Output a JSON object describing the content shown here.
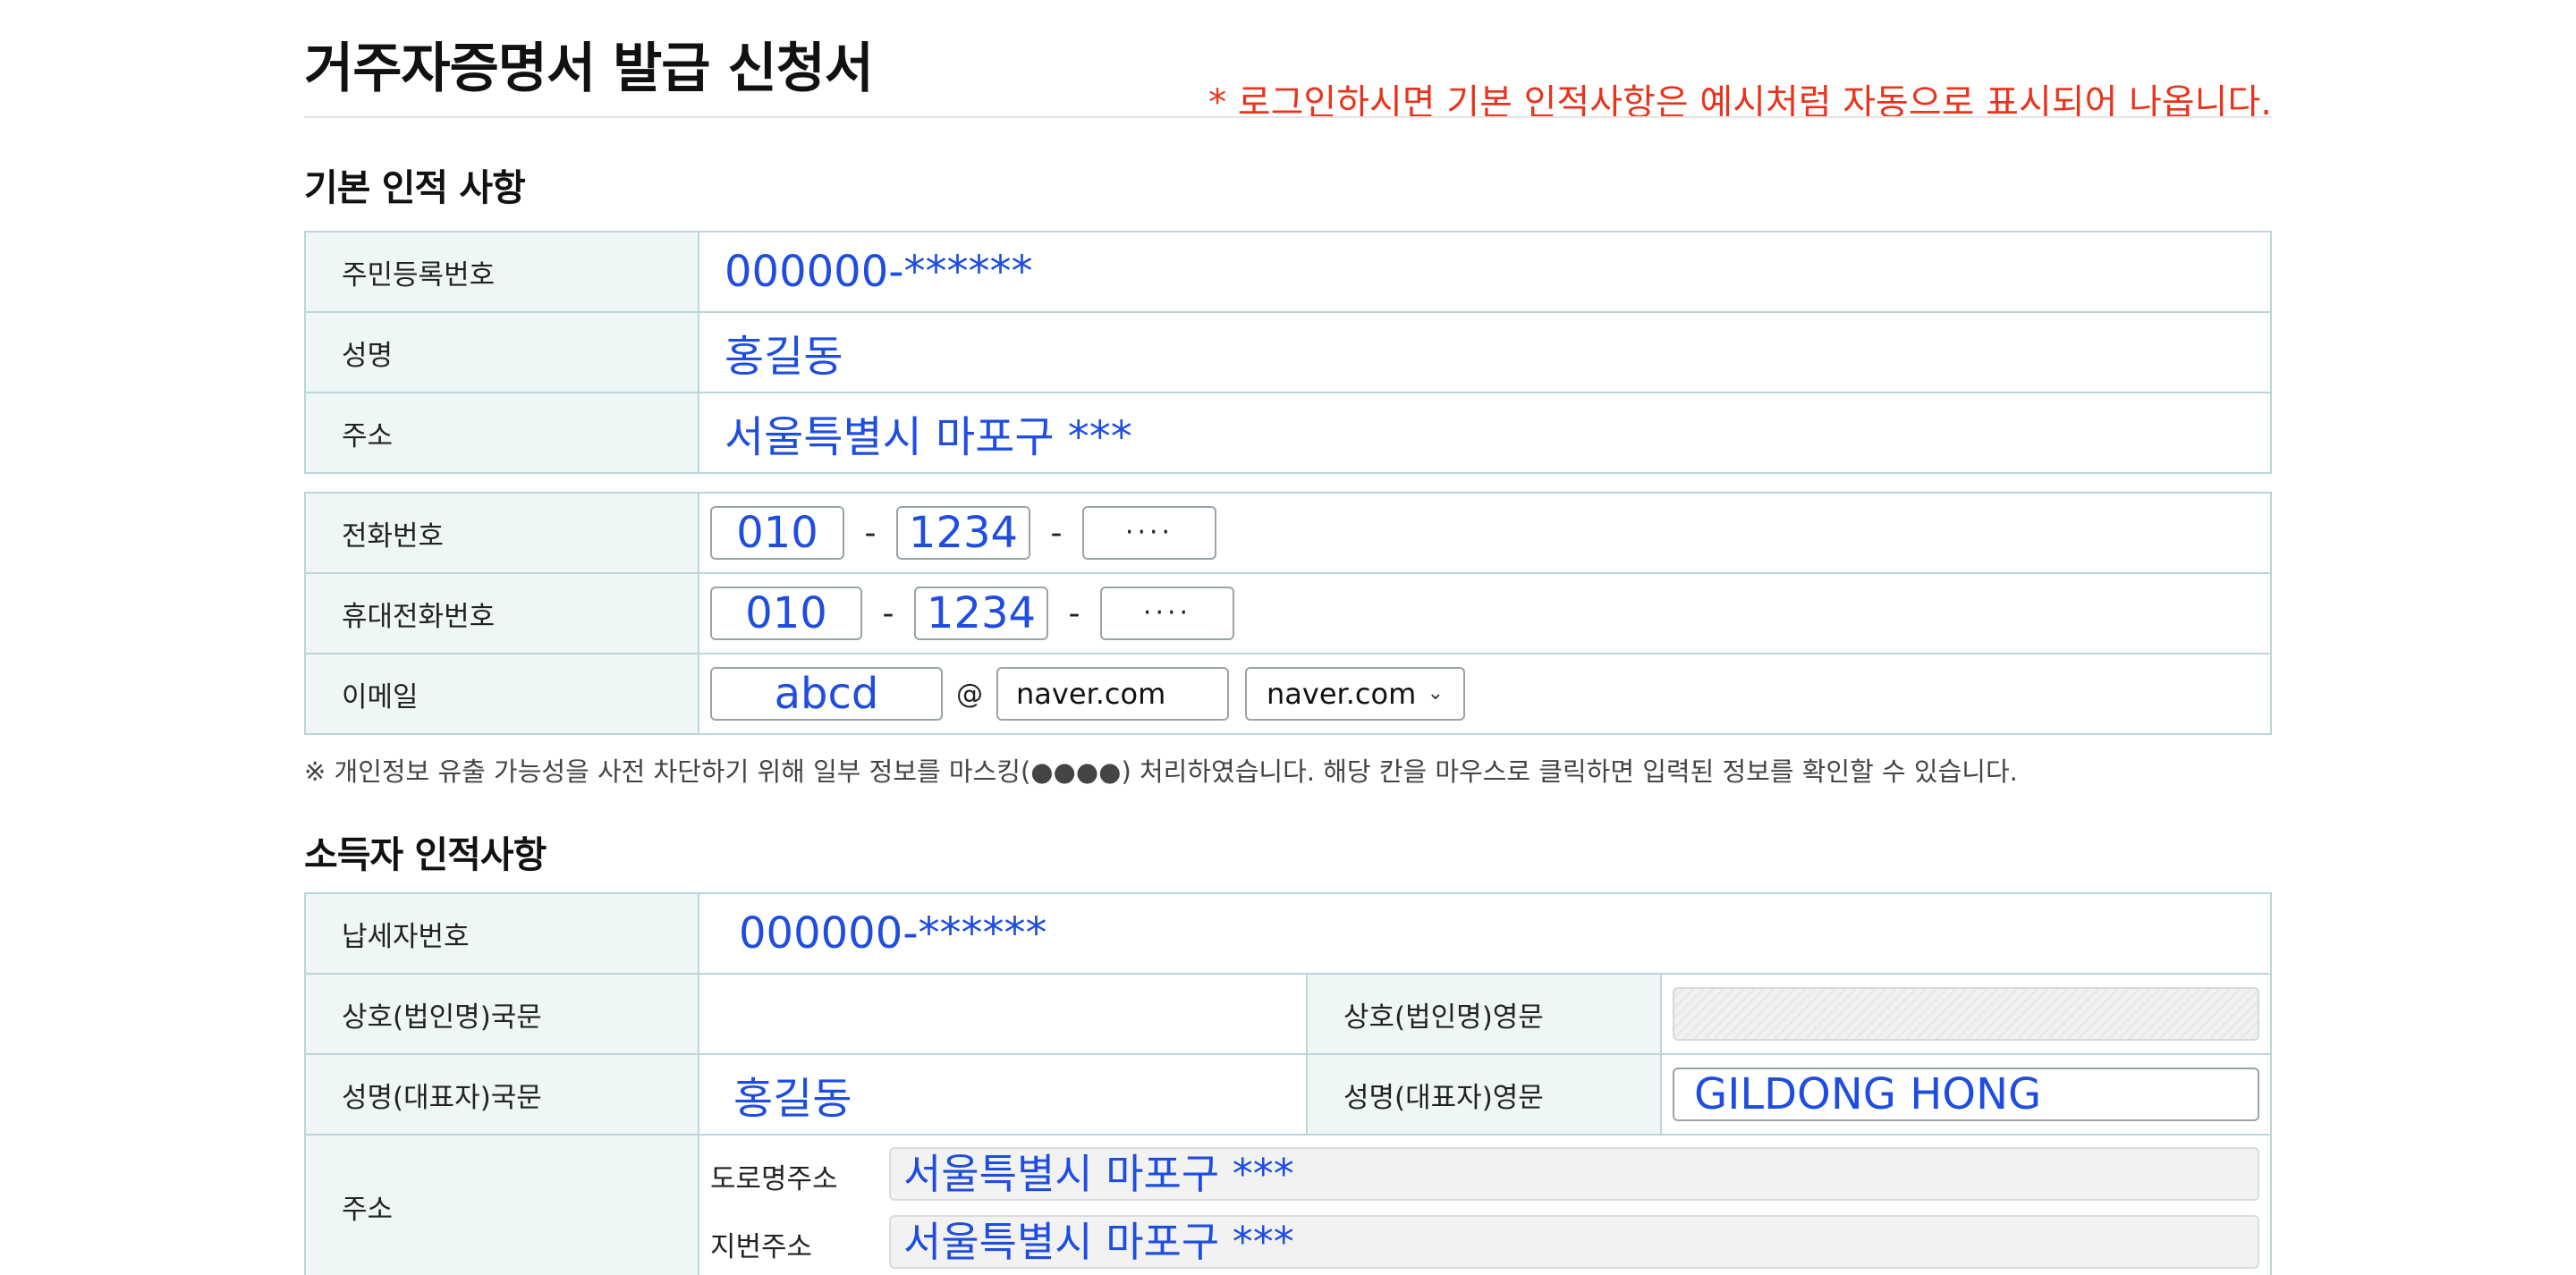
{
  "header": {
    "title": "거주자증명서 발급 신청서",
    "notice": "* 로그인하시면 기본 인적사항은 예시처럼 자동으로 표시되어 나옵니다."
  },
  "basic": {
    "section_title": "기본 인적 사항",
    "rrn_label": "주민등록번호",
    "rrn_value": "000000-******",
    "name_label": "성명",
    "name_value": "홍길동",
    "address_label": "주소",
    "address_value": "서울특별시 마포구 ***",
    "phone_label": "전화번호",
    "phone": [
      "010",
      "1234",
      "····"
    ],
    "mobile_label": "휴대전화번호",
    "mobile": [
      "010",
      "1234",
      "····"
    ],
    "email_label": "이메일",
    "email_id": "abcd",
    "email_at": "@",
    "email_domain": "naver.com",
    "email_domain_select": "naver.com",
    "dash": "-"
  },
  "footnote": "※ 개인정보 유출 가능성을 사전 차단하기 위해 일부 정보를 마스킹(●●●●) 처리하였습니다. 해당 칸을 마우스로 클릭하면 입력된 정보를 확인할 수 있습니다.",
  "income": {
    "section_title": "소득자 인적사항",
    "taxpayer_label": "납세자번호",
    "taxpayer_value": "000000-******",
    "company_kr_label": "상호(법인명)국문",
    "company_kr_value": "",
    "company_en_label": "상호(법인명)영문",
    "company_en_value": "",
    "rep_kr_label": "성명(대표자)국문",
    "rep_kr_value": "홍길동",
    "rep_en_label": "성명(대표자)영문",
    "rep_en_value": "GILDONG HONG",
    "address_label": "주소",
    "road_label": "도로명주소",
    "road_value": "서울특별시 마포구 ***",
    "lot_label": "지번주소",
    "lot_value": "서울특별시 마포구 ***"
  }
}
